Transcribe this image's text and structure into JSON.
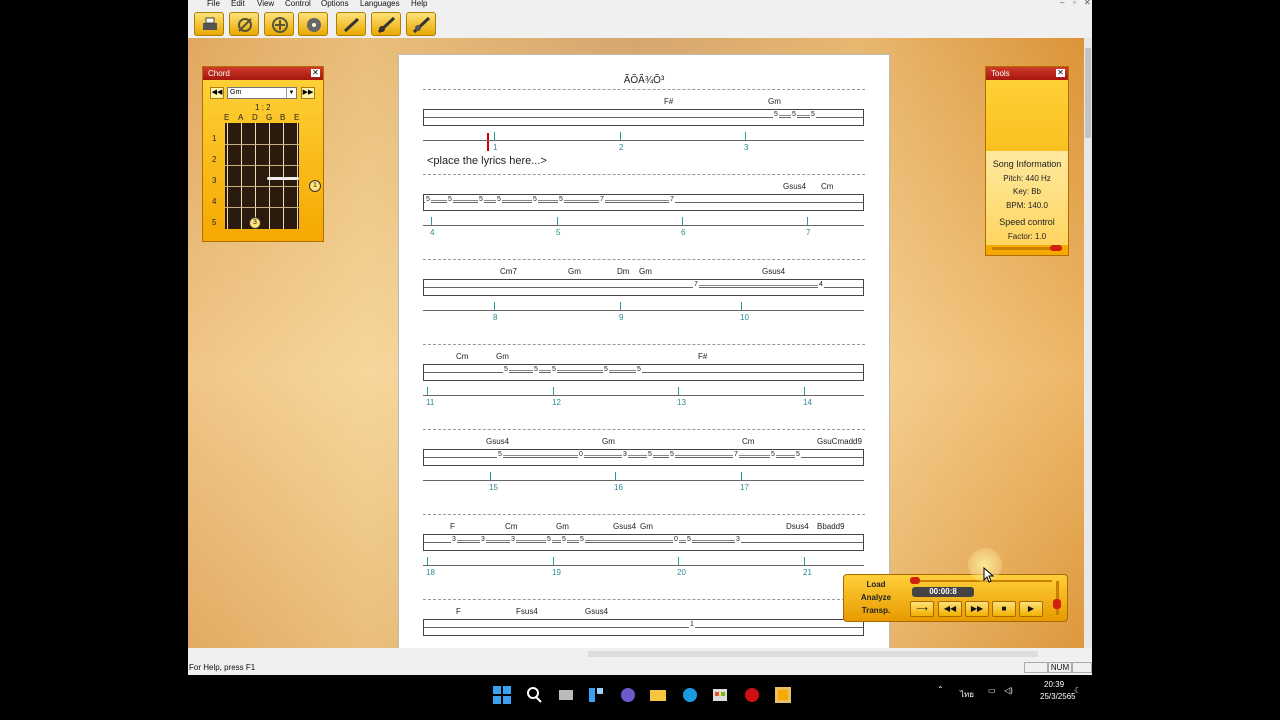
{
  "menu": [
    "File",
    "Edit",
    "View",
    "Control",
    "Options",
    "Languages",
    "Help"
  ],
  "window_controls": [
    "–",
    "▫",
    "✕"
  ],
  "toolbar_icons": [
    "print-icon",
    "tuning-fork-icon",
    "add-icon",
    "disc-icon",
    "pencil-icon",
    "guitar-icon",
    "guitar-edit-icon"
  ],
  "song_title": "ÃÕÃ¾Õ³",
  "lyrics_placeholder": "<place the lyrics here...>",
  "chord_panel": {
    "title": "Chord",
    "selected_chord": "Gm",
    "ratio": "1 : 2",
    "strings": [
      "E",
      "A",
      "D",
      "G",
      "B",
      "E"
    ],
    "frets": [
      "1",
      "2",
      "3",
      "4",
      "5"
    ],
    "finger_3": "3",
    "finger_1": "1"
  },
  "tools_panel": {
    "title": "Tools",
    "song_info_label": "Song Information",
    "pitch": "Pitch: 440 Hz",
    "key": "Key: Bb",
    "bpm": "BPM: 140.0",
    "speed_label": "Speed control",
    "factor": "Factor: 1.0"
  },
  "player": {
    "load": "Load",
    "analyze": "Analyze",
    "transp": "Transp.",
    "time": "00:00:8",
    "controls": [
      "⟶",
      "◀◀",
      "▶▶",
      "■",
      "▶"
    ]
  },
  "status": {
    "help": "For Help, press F1",
    "num": "NUM"
  },
  "clock": {
    "time": "20:39",
    "date": "25/3/2565"
  },
  "tray_lang": "ไทย",
  "rows": [
    {
      "chords": [
        [
          "F#",
          265
        ],
        [
          "Gm",
          369
        ]
      ],
      "frets": [
        [
          "5",
          374
        ],
        [
          "5",
          392
        ],
        [
          "5",
          411
        ]
      ],
      "bars": [
        [
          "1",
          95
        ],
        [
          "2",
          221
        ],
        [
          "3",
          346
        ]
      ]
    },
    {
      "chords": [
        [
          "Gsus4",
          384
        ],
        [
          "Cm",
          422
        ]
      ],
      "frets": [
        [
          "5",
          26
        ],
        [
          "5",
          48
        ],
        [
          "5",
          79
        ],
        [
          "5",
          97
        ],
        [
          "5",
          133
        ],
        [
          "5",
          159
        ],
        [
          "7",
          200
        ],
        [
          "7",
          270
        ]
      ],
      "bars": [
        [
          "4",
          32
        ],
        [
          "5",
          158
        ],
        [
          "6",
          283
        ],
        [
          "7",
          408
        ]
      ]
    },
    {
      "chords": [
        [
          "Cm7",
          101
        ],
        [
          "Gm",
          169
        ],
        [
          "Dm",
          218
        ],
        [
          "Gm",
          240
        ],
        [
          "Gsus4",
          363
        ]
      ],
      "frets": [
        [
          "7",
          294
        ],
        [
          "4",
          419
        ]
      ],
      "bars": [
        [
          "8",
          95
        ],
        [
          "9",
          221
        ],
        [
          "10",
          342
        ]
      ]
    },
    {
      "chords": [
        [
          "Cm",
          57
        ],
        [
          "Gm",
          97
        ],
        [
          "F#",
          299
        ]
      ],
      "frets": [
        [
          "5",
          104
        ],
        [
          "5",
          134
        ],
        [
          "5",
          152
        ],
        [
          "5",
          204
        ],
        [
          "5",
          237
        ]
      ],
      "bars": [
        [
          "11",
          28
        ],
        [
          "12",
          154
        ],
        [
          "13",
          279
        ],
        [
          "14",
          405
        ]
      ]
    },
    {
      "chords": [
        [
          "Gsus4",
          87
        ],
        [
          "Gm",
          203
        ],
        [
          "Cm",
          343
        ],
        [
          "GsuCmadd9",
          418
        ]
      ],
      "frets": [
        [
          "5",
          98
        ],
        [
          "0",
          179
        ],
        [
          "3",
          223
        ],
        [
          "5",
          248
        ],
        [
          "5",
          270
        ],
        [
          "7",
          334
        ],
        [
          "5",
          371
        ],
        [
          "5",
          396
        ]
      ],
      "bars": [
        [
          "15",
          91
        ],
        [
          "16",
          216
        ],
        [
          "17",
          342
        ]
      ]
    },
    {
      "chords": [
        [
          "F",
          51
        ],
        [
          "Cm",
          106
        ],
        [
          "Gm",
          157
        ],
        [
          "Gsus4",
          214
        ],
        [
          "Gm",
          241
        ],
        [
          "Dsus4",
          387
        ],
        [
          "Bbadd9",
          418
        ]
      ],
      "frets": [
        [
          "3",
          52
        ],
        [
          "3",
          81
        ],
        [
          "3",
          111
        ],
        [
          "5",
          147
        ],
        [
          "5",
          162
        ],
        [
          "5",
          180
        ],
        [
          "0",
          274
        ],
        [
          "5",
          287
        ],
        [
          "3",
          336
        ]
      ],
      "bars": [
        [
          "18",
          28
        ],
        [
          "19",
          154
        ],
        [
          "20",
          279
        ],
        [
          "21",
          405
        ]
      ]
    },
    {
      "chords": [
        [
          "F",
          57
        ],
        [
          "Fsus4",
          117
        ],
        [
          "Gsus4",
          186
        ]
      ],
      "frets": [
        [
          "1",
          290
        ]
      ],
      "bars": []
    }
  ]
}
